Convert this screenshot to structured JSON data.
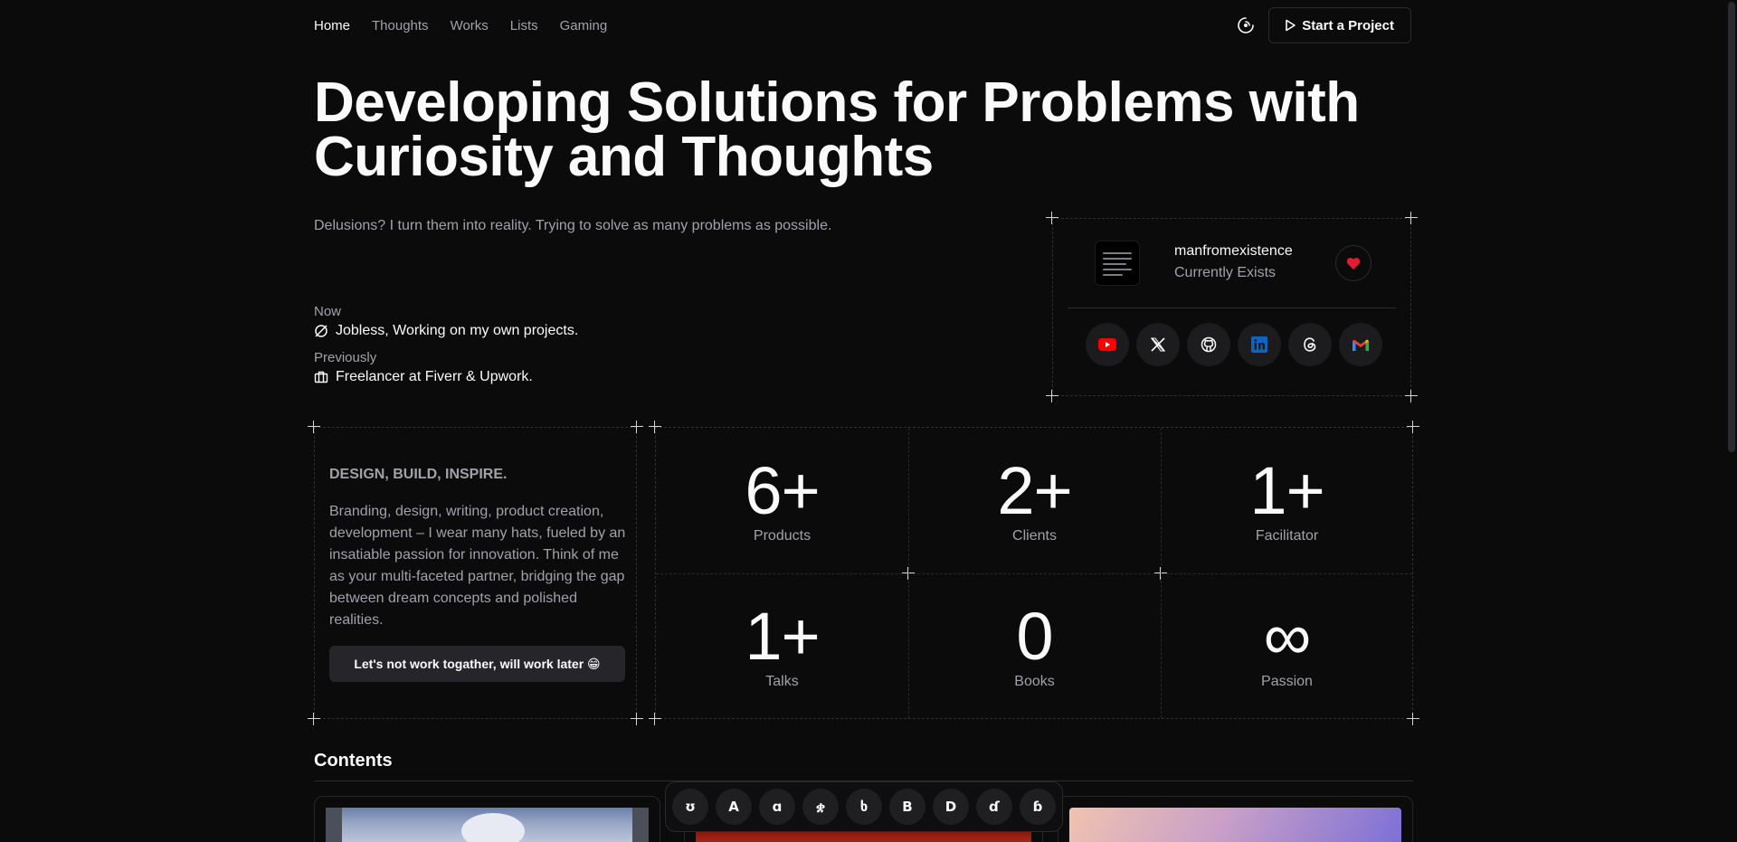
{
  "nav": {
    "links": [
      "Home",
      "Thoughts",
      "Works",
      "Lists",
      "Gaming"
    ],
    "cta_label": "Start a Project"
  },
  "hero": {
    "title_line1": "Developing Solutions for Problems with",
    "title_line2": "Curiosity and Thoughts",
    "subtitle": "Delusions? I turn them into reality. Trying to solve as many problems as possible."
  },
  "status": {
    "now_label": "Now",
    "now_value": "Jobless, Working on my own projects.",
    "prev_label": "Previously",
    "prev_value": "Freelancer at Fiverr & Upwork."
  },
  "profile": {
    "name": "manfromexistence",
    "status": "Currently Exists",
    "socials": [
      "youtube-icon",
      "x-icon",
      "github-icon",
      "linkedin-icon",
      "threads-icon",
      "gmail-icon"
    ]
  },
  "about": {
    "tagline": "DESIGN, BUILD, INSPIRE.",
    "text": "Branding, design, writing, product creation, development – I wear many hats, fueled by an insatiable passion for innovation. Think of me as your multi-faceted partner, bridging the gap between dream concepts and polished realities.",
    "button": "Let's not work togather, will work later 😁"
  },
  "stats": [
    {
      "value": "6+",
      "label": "Products"
    },
    {
      "value": "2+",
      "label": "Clients"
    },
    {
      "value": "1+",
      "label": "Facilitator"
    },
    {
      "value": "1+",
      "label": "Talks"
    },
    {
      "value": "0",
      "label": "Books"
    },
    {
      "value": "∞",
      "label": "Passion"
    }
  ],
  "contents": {
    "title": "Contents"
  },
  "dock": [
    "ʊ",
    "A",
    "ɑ",
    "ቋ",
    "ხ",
    "B",
    "D",
    "ɗ",
    "ɓ"
  ],
  "colors": {
    "background": "#0b0b0c",
    "text": "#fafafa",
    "muted": "#a1a1aa",
    "heart": "#e11d2e",
    "youtube": "#ff0000",
    "linkedin": "#0a66c2"
  }
}
